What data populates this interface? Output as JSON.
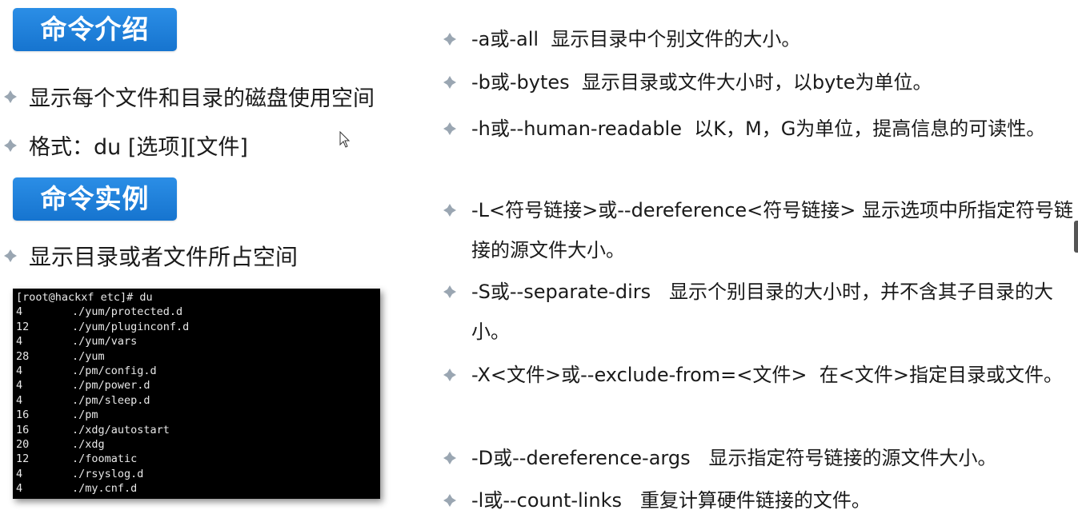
{
  "left": {
    "intro_badge": "命令介绍",
    "intro_bullets": [
      "显示每个文件和目录的磁盘使用空间",
      "格式：du [选项][文件]"
    ],
    "example_badge": "命令实例",
    "example_bullet": "显示目录或者文件所占空间"
  },
  "terminal": {
    "prompt": "[root@hackxf etc]# du",
    "rows": [
      {
        "size": "4",
        "path": "./yum/protected.d"
      },
      {
        "size": "12",
        "path": "./yum/pluginconf.d"
      },
      {
        "size": "4",
        "path": "./yum/vars"
      },
      {
        "size": "28",
        "path": "./yum"
      },
      {
        "size": "4",
        "path": "./pm/config.d"
      },
      {
        "size": "4",
        "path": "./pm/power.d"
      },
      {
        "size": "4",
        "path": "./pm/sleep.d"
      },
      {
        "size": "16",
        "path": "./pm"
      },
      {
        "size": "16",
        "path": "./xdg/autostart"
      },
      {
        "size": "20",
        "path": "./xdg"
      },
      {
        "size": "12",
        "path": "./foomatic"
      },
      {
        "size": "4",
        "path": "./rsyslog.d"
      },
      {
        "size": "4",
        "path": "./my.cnf.d"
      }
    ]
  },
  "options": [
    "-a或-all  显示目录中个别文件的大小。",
    "-b或-bytes  显示目录或文件大小时，以byte为单位。",
    "-h或--human-readable  以K，M，G为单位，提高信息的可读性。",
    "-L<符号链接>或--dereference<符号链接> 显示选项中所指定符号链接的源文件大小。",
    "-S或--separate-dirs   显示个别目录的大小时，并不含其子目录的大小。",
    "-X<文件>或--exclude-from=<文件>  在<文件>指定目录或文件。",
    "-D或--dereference-args   显示指定符号链接的源文件大小。",
    "-l或--count-links   重复计算硬件链接的文件。"
  ],
  "icons": {
    "bullet": "diamond-bullet-icon",
    "cursor": "mouse-pointer-icon"
  },
  "colors": {
    "badge": "#1674cf",
    "bullet": "#9aa6b2",
    "terminal_bg": "#000000"
  }
}
